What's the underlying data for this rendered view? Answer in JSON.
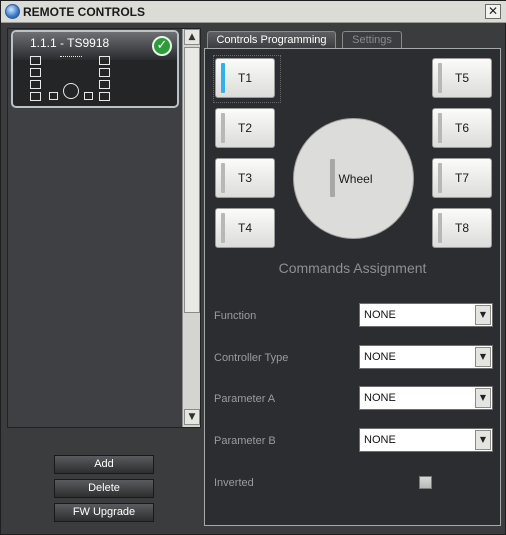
{
  "window": {
    "title": "REMOTE CONTROLS",
    "close_glyph": "✕"
  },
  "device": {
    "name": "1.1.1 - TS9918",
    "status_icon": "check-icon"
  },
  "left_buttons": {
    "add": "Add",
    "delete": "Delete",
    "fw_upgrade": "FW Upgrade"
  },
  "tabs": [
    {
      "label": "Controls Programming",
      "active": true
    },
    {
      "label": "Settings",
      "active": false
    }
  ],
  "buttons": {
    "t1": "T1",
    "t2": "T2",
    "t3": "T3",
    "t4": "T4",
    "t5": "T5",
    "t6": "T6",
    "t7": "T7",
    "t8": "T8",
    "wheel": "Wheel"
  },
  "assignment": {
    "title": "Commands Assignment",
    "function": {
      "label": "Function",
      "value": "NONE"
    },
    "controller_type": {
      "label": "Controller Type",
      "value": "NONE"
    },
    "parameter_a": {
      "label": "Parameter A",
      "value": "NONE"
    },
    "parameter_b": {
      "label": "Parameter B",
      "value": "NONE"
    },
    "inverted": {
      "label": "Inverted",
      "checked": false
    }
  },
  "colors": {
    "selection_bar": "#33b0e8",
    "status_ok": "#2d9b3a",
    "panel_bg": "#2c2d30"
  }
}
